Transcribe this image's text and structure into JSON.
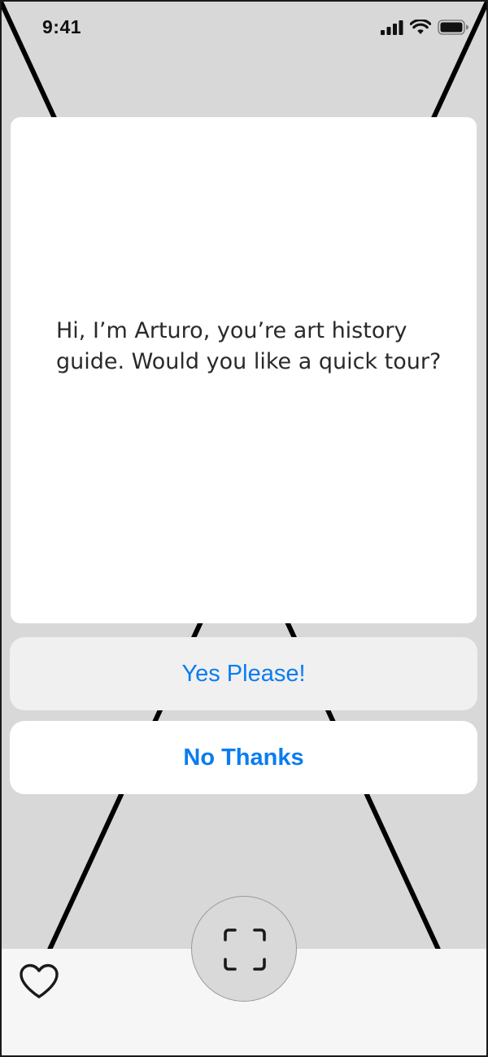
{
  "status_bar": {
    "time": "9:41",
    "icons": [
      "signal-icon",
      "wifi-icon",
      "battery-icon"
    ]
  },
  "dialog": {
    "message": "Hi, I’m Arturo, you’re art history guide. Would you like a quick tour?"
  },
  "actions": {
    "yes_label": "Yes Please!",
    "no_label": "No Thanks"
  },
  "bottom_bar": {
    "favorite_icon": "heart-icon",
    "scan_icon": "scan-frame-icon"
  },
  "colors": {
    "accent": "#0a7cf0",
    "background": "#d8d8d8",
    "card": "#ffffff",
    "bottom_bar": "#f6f6f6"
  }
}
